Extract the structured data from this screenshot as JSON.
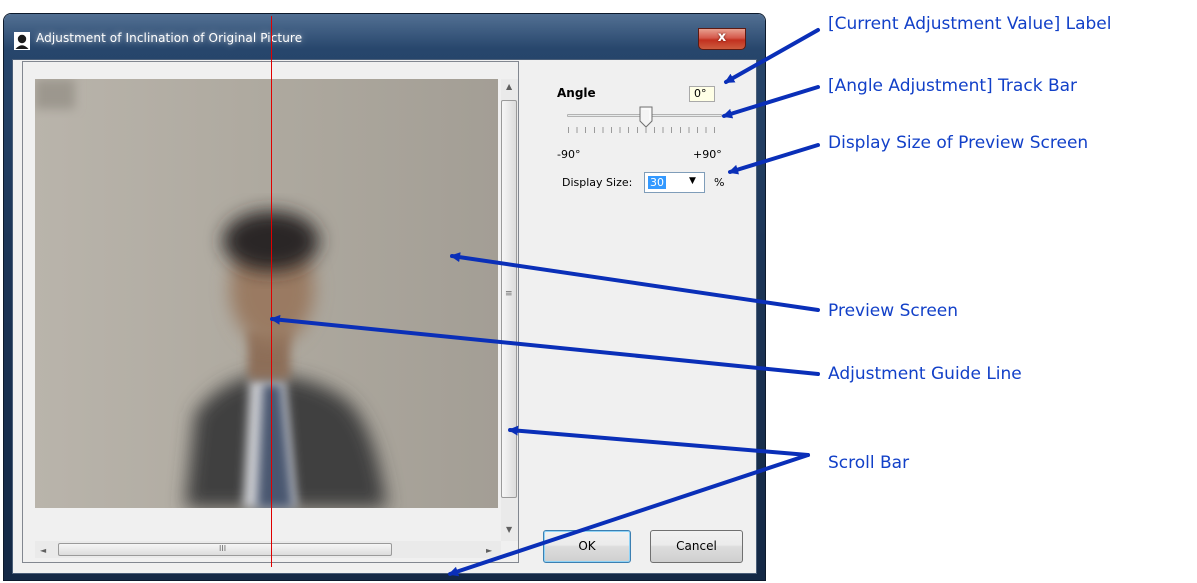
{
  "window": {
    "title": "Adjustment of Inclination of Original Picture",
    "close_glyph": "x"
  },
  "angle": {
    "label": "Angle",
    "value": "0°",
    "min_label": "-90°",
    "max_label": "+90°",
    "slider_value_deg": 0,
    "slider_range_deg": [
      -90,
      90
    ]
  },
  "display_size": {
    "label": "Display Size:",
    "value": "30",
    "unit": "%"
  },
  "buttons": {
    "ok": "OK",
    "cancel": "Cancel"
  },
  "scrollbar_glyphs": {
    "up": "▲",
    "down": "▼",
    "left": "◄",
    "right": "►",
    "v_grip": "≡",
    "h_grip": "III"
  },
  "annotations": {
    "current_value_label": "[Current Adjustment Value] Label",
    "angle_track_bar": "[Angle Adjustment] Track Bar",
    "display_size": "Display Size of Preview Screen",
    "preview_screen": "Preview Screen",
    "guide_line": "Adjustment Guide Line",
    "scroll_bar": "Scroll Bar"
  },
  "colors": {
    "annotation_text": "#1240c8",
    "annotation_arrow": "#0a2fb8",
    "guide_line": "#e00000",
    "selection": "#3399ff",
    "value_box_bg": "#ffffe6"
  },
  "icons": [
    "person-icon",
    "close-icon",
    "scroll-up-icon",
    "scroll-down-icon",
    "scroll-left-icon",
    "scroll-right-icon",
    "dropdown-arrow-icon",
    "slider-thumb-icon"
  ]
}
